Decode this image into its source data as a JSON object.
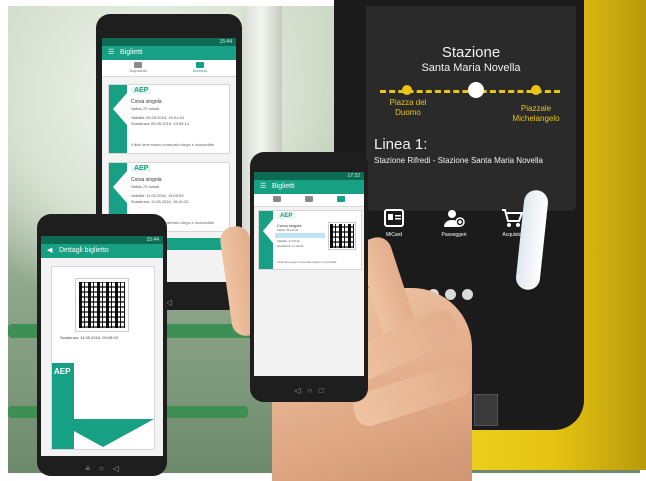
{
  "validator": {
    "station_label": "Stazione",
    "station_name": "Santa Maria Novella",
    "stop_left": "Piazza del Duomo",
    "stop_right": "Piazzale Michelangelo",
    "line_title": "Linea 1:",
    "line_route": "Stazione Rifredi - Stazione Santa Maria Novella",
    "buttons": [
      {
        "label": "MiCard",
        "icon": "card-icon"
      },
      {
        "label": "Passeggeri",
        "icon": "user-add-icon"
      },
      {
        "label": "Acquista",
        "icon": "cart-icon"
      }
    ],
    "colors": {
      "accent": "#e6c611",
      "screen": "#2a2a2a"
    }
  },
  "phone_tickets": {
    "status_time": "15:44",
    "title": "Biglietti",
    "tabs": [
      "Acquistati",
      "Archivio"
    ],
    "tickets": [
      {
        "logo": "AEP",
        "title": "Corsa singola",
        "subtitle": "Valido 70 minuti",
        "validity": "Validità: 09.05.2016, 15:01:44",
        "expiry": "Scadenza: 09.05.2016, 15:53:14",
        "note": "Il titolo deve essere conservato integro e riconoscibile"
      },
      {
        "logo": "AEP",
        "title": "Corsa singola",
        "subtitle": "Valido 70 minuti",
        "validity": "Validità: 11.05.2016, 15:09:53",
        "expiry": "Scadenza: 11.05.2016, 15:41:23",
        "note": "Il titolo deve essere conservato integro e riconoscibile"
      }
    ]
  },
  "phone_detail": {
    "status_time": "15:44",
    "title": "Dettagli biglietto",
    "expiry": "Scadenza: 14.05.2016, 09:05:03",
    "logo": "AEP"
  },
  "phone_hand": {
    "status_time": "17:32",
    "title": "Biglietti",
    "ticket": {
      "logo": "AEP",
      "title": "Corsa singola",
      "subtitle": "Valido 70 minuti",
      "validity": "Validità: 17.02.11",
      "expiry": "Scadenza: 17.03.41",
      "note": "Il titolo deve essere conservato integro e riconoscibile"
    }
  },
  "colors": {
    "brand": "#17a084",
    "dark_brand": "#0e6b53"
  }
}
